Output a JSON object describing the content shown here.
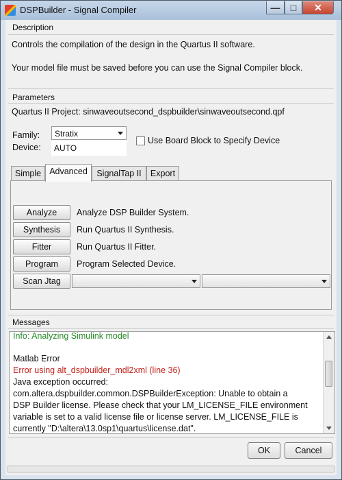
{
  "window": {
    "title": "DSPBuilder - Signal Compiler",
    "controls": {
      "minimize": "—",
      "maximize": "□",
      "close": "✕"
    }
  },
  "description": {
    "heading": "Description",
    "line1": "Controls the compilation of the design in the Quartus II software.",
    "line2": "Your model file must be saved before you can use the Signal Compiler block."
  },
  "parameters": {
    "heading": "Parameters",
    "project_line": "Quartus II Project: sinwaveoutsecond_dspbuilder\\sinwaveoutsecond.qpf",
    "family_label": "Family:",
    "family_value": "Stratix",
    "device_label": "Device:",
    "device_value": "AUTO",
    "board_block_label": "Use Board Block to Specify Device",
    "board_block_checked": false
  },
  "tabs": [
    {
      "label": "Simple"
    },
    {
      "label": "Advanced"
    },
    {
      "label": "SignalTap II"
    },
    {
      "label": "Export"
    }
  ],
  "active_tab": "Advanced",
  "actions": [
    {
      "button": "Analyze",
      "description": "Analyze DSP Builder System."
    },
    {
      "button": "Synthesis",
      "description": "Run Quartus II Synthesis."
    },
    {
      "button": "Fitter",
      "description": "Run Quartus II Fitter."
    },
    {
      "button": "Program",
      "description": "Program Selected Device."
    },
    {
      "button": "Scan Jtag",
      "description": ""
    }
  ],
  "messages": {
    "heading": "Messages",
    "lines": [
      {
        "text": "Info: Analyzing Simulink model",
        "color": "#2a8a2a"
      },
      {
        "text": "",
        "color": "#111111"
      },
      {
        "text": "Matlab Error",
        "color": "#111111"
      },
      {
        "text": "Error using alt_dspbuilder_mdl2xml (line 36)",
        "color": "#c0201a"
      },
      {
        "text": "Java exception occurred:",
        "color": "#111111"
      },
      {
        "text": "com.altera.dspbuilder.common.DSPBuilderException: Unable to obtain a",
        "color": "#111111"
      },
      {
        "text": "DSP Builder license. Please check that your LM_LICENSE_FILE environment",
        "color": "#111111"
      },
      {
        "text": "variable is set to a valid license file or license server. LM_LICENSE_FILE is",
        "color": "#111111"
      },
      {
        "text": "currently \"D:\\altera\\13.0sp1\\quartus\\license.dat\".",
        "color": "#111111"
      }
    ]
  },
  "footer": {
    "ok": "OK",
    "cancel": "Cancel"
  }
}
